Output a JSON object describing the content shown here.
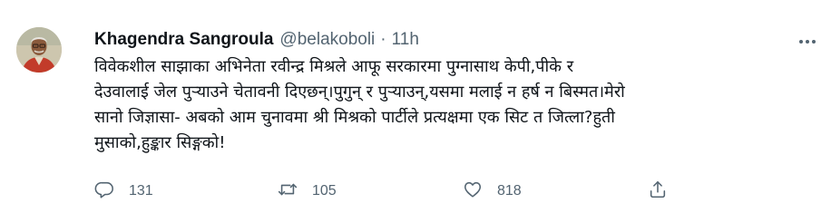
{
  "tweet": {
    "author_name": "Khagendra Sangroula",
    "handle": "@belakoboli",
    "separator": "·",
    "timestamp": "11h",
    "body_lines": [
      "विवेकशील साझाका अभिनेता रवीन्द्र मिश्रले अ‍ाफू सरकारमा पुग्नासाथ केपी,पीके र",
      "देउवालाई जेल पुर्‍याउने चेतावनी दिएछन्।पुगुन् र पुर्‍याउन्,यसमा मलाई न हर्ष न बिस्मत।मेरो",
      "सानो जिज्ञासा- अबको अ‍ाम चुनावमा श्री मिश्रको पार्टीले प्रत्यक्षमा एक सिट त जित्ला?हुती",
      "मुसाको,हुङ्कार सिङ्गको!"
    ],
    "actions": {
      "reply_count": "131",
      "retweet_count": "105",
      "like_count": "818"
    }
  },
  "icons": {
    "reply": "comment-bubble-icon",
    "retweet": "retweet-arrows-icon",
    "like": "heart-outline-icon",
    "share": "share-upload-icon",
    "more": "more-dots-icon"
  },
  "colors": {
    "text_primary": "#0f1419",
    "text_secondary": "#536471",
    "background": "#ffffff"
  }
}
